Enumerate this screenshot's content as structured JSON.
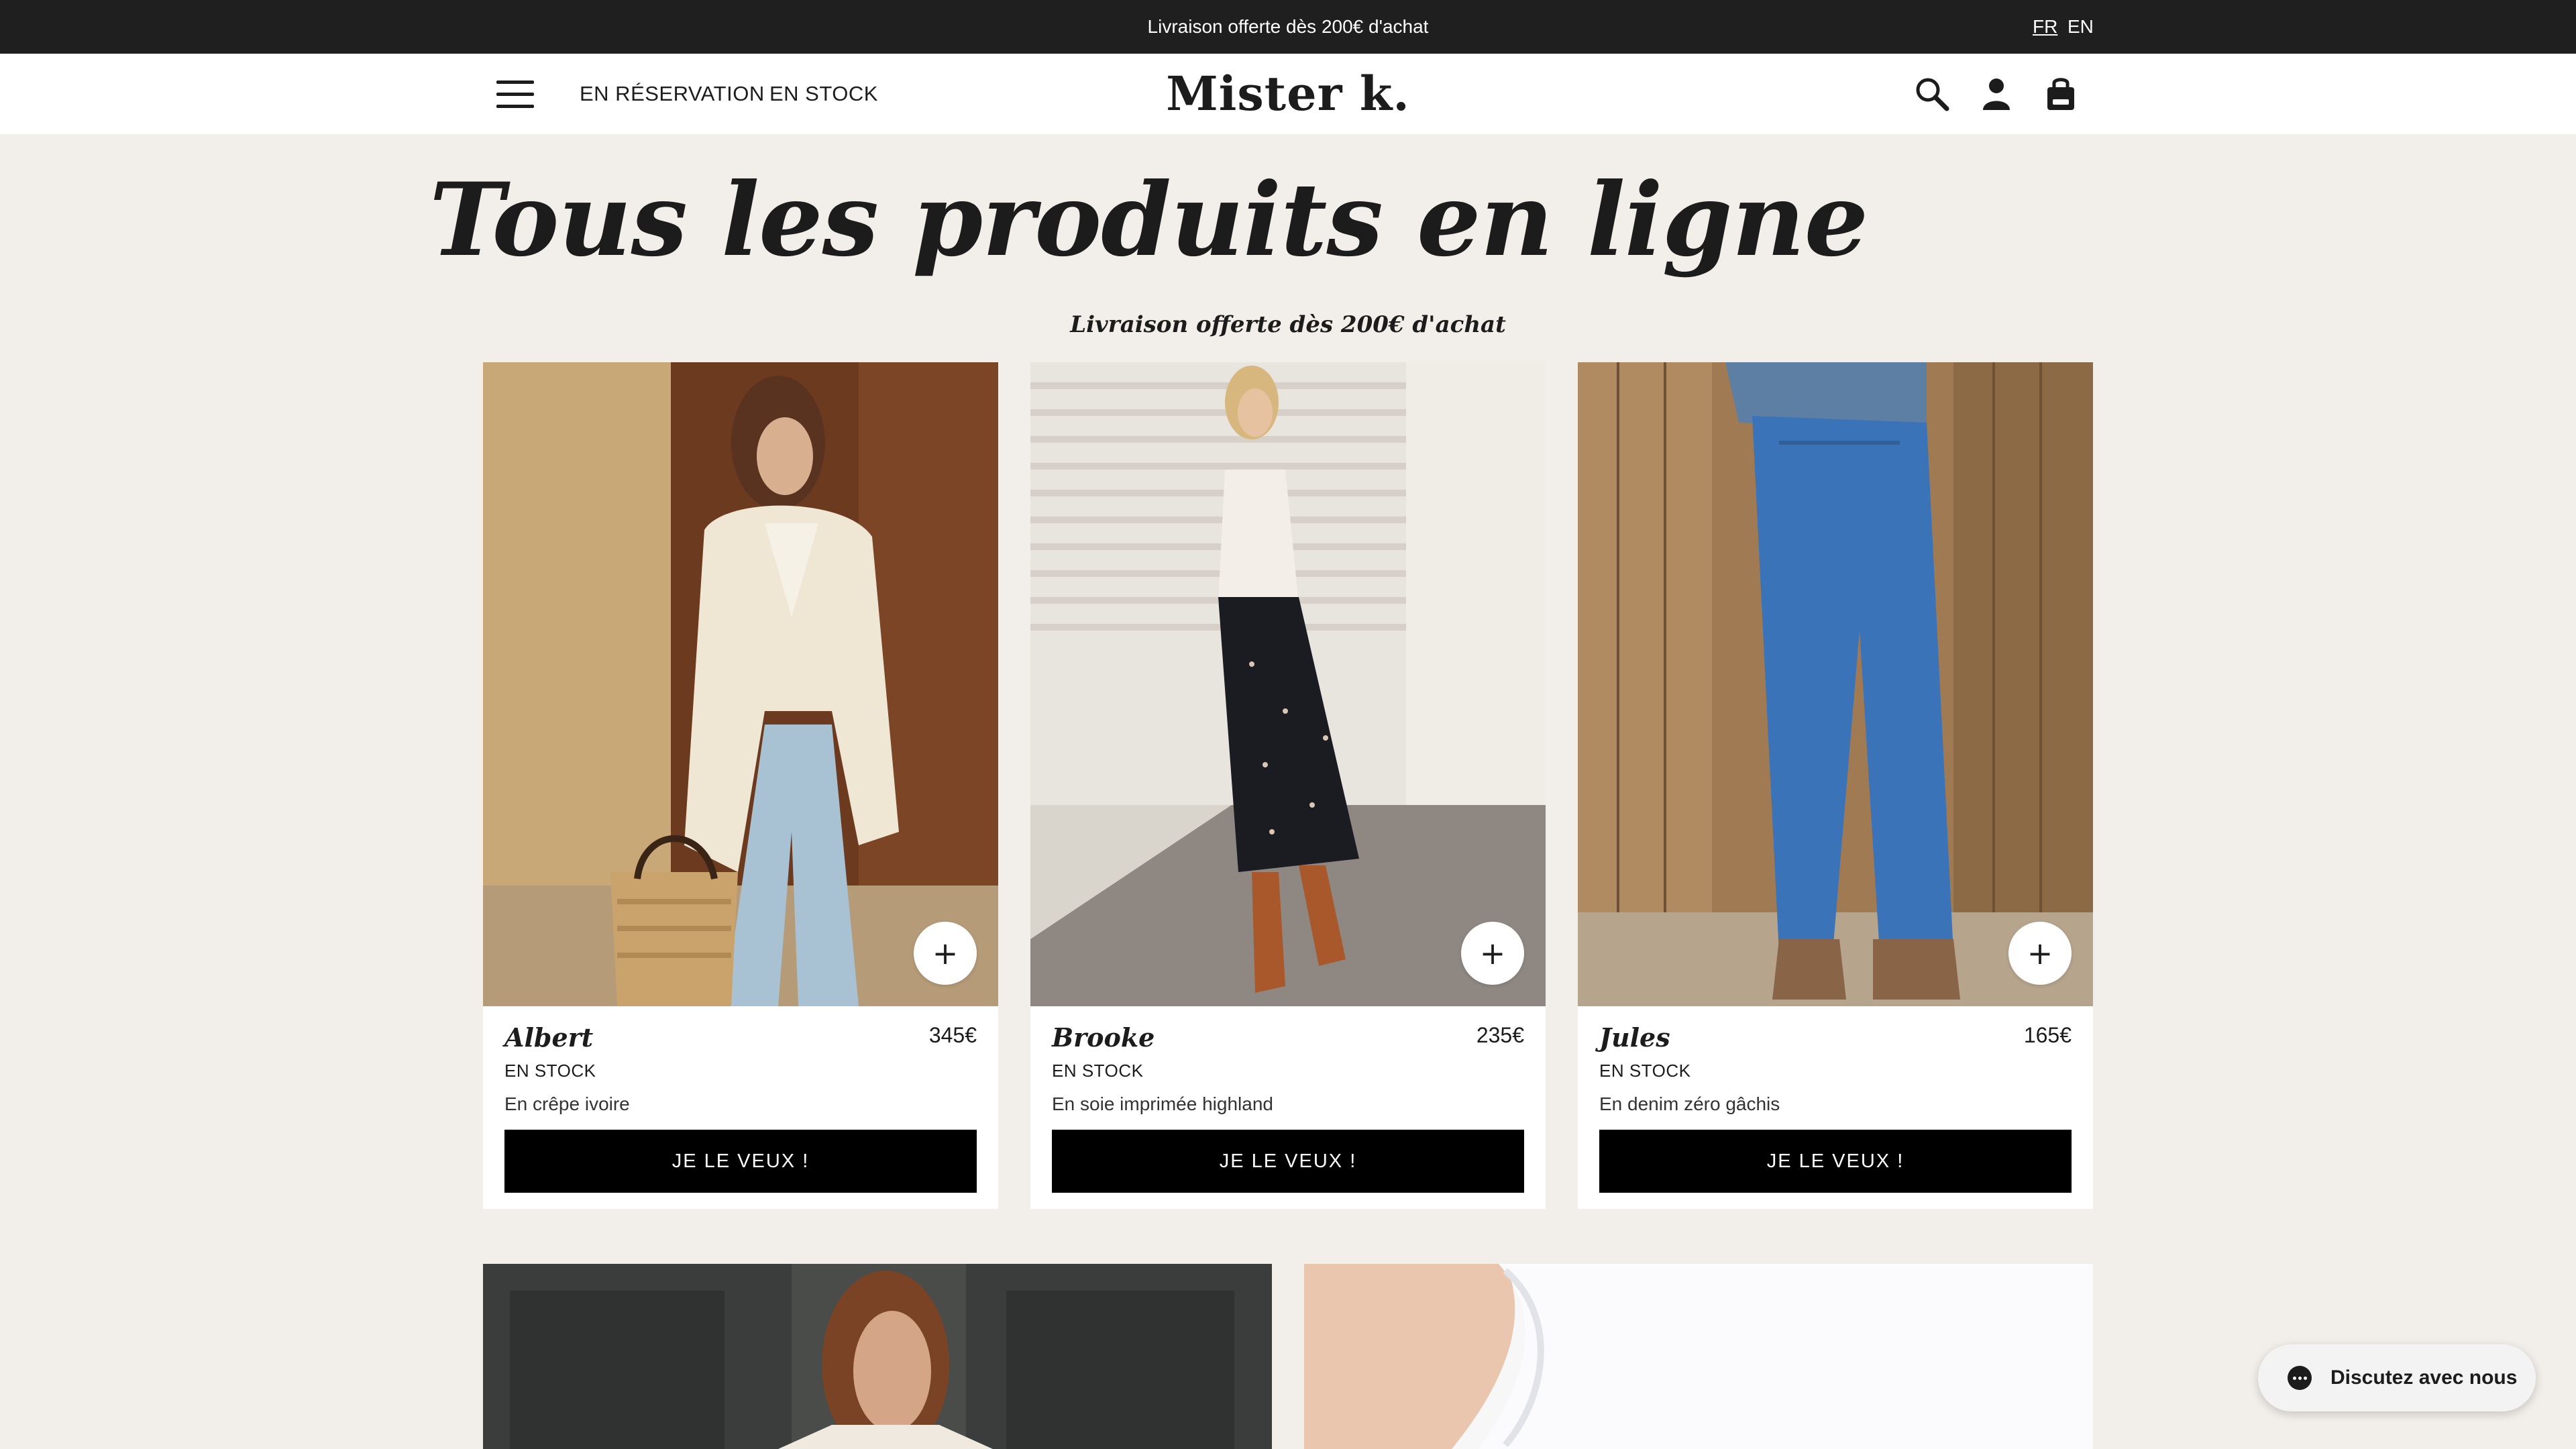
{
  "announcement": {
    "message": "Livraison offerte dès 200€ d'achat",
    "languages": [
      "FR",
      "EN"
    ],
    "active_language": "FR"
  },
  "header": {
    "nav": [
      "EN RÉSERVATION",
      "EN STOCK"
    ],
    "logo": "Mister k.",
    "icons": [
      "menu-icon",
      "search-icon",
      "account-icon",
      "bag-icon"
    ]
  },
  "page": {
    "title": "Tous les produits en ligne",
    "subtitle": "Livraison offerte dès 200€ d'achat"
  },
  "products": [
    {
      "name": "Albert",
      "price": "345€",
      "stock": "EN STOCK",
      "description": "En crêpe ivoire",
      "cta": "JE LE VEUX !",
      "quick_add": "+"
    },
    {
      "name": "Brooke",
      "price": "235€",
      "stock": "EN STOCK",
      "description": "En soie imprimée highland",
      "cta": "JE LE VEUX !",
      "quick_add": "+"
    },
    {
      "name": "Jules",
      "price": "165€",
      "stock": "EN STOCK",
      "description": "En denim zéro gâchis",
      "cta": "JE LE VEUX !",
      "quick_add": "+"
    }
  ],
  "chat": {
    "label": "Discutez avec nous"
  },
  "colors": {
    "background": "#f2eeea",
    "topbar": "#1f1f1f",
    "button": "#000000",
    "card": "#ffffff"
  }
}
